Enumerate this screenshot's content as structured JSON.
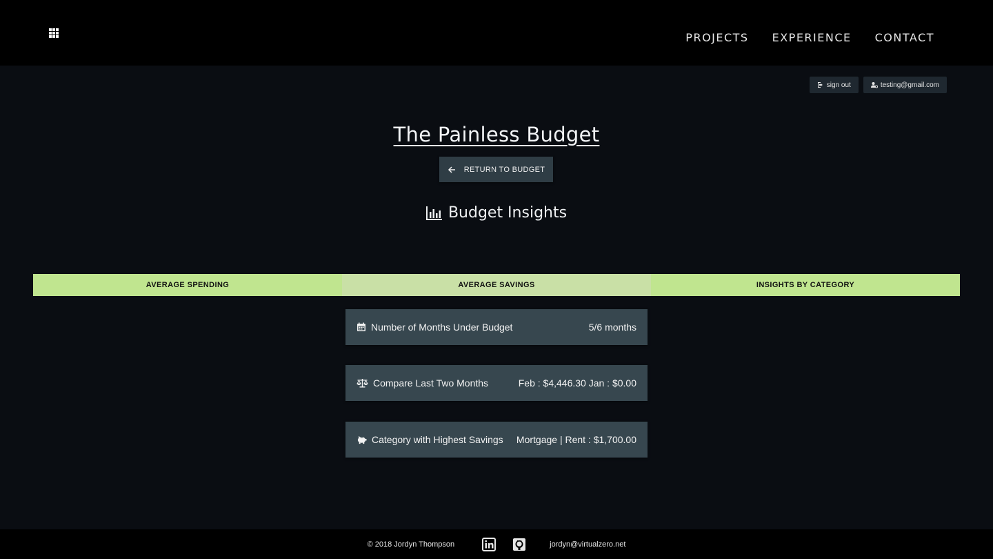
{
  "nav": {
    "menu_icon": "grid-icon",
    "links": [
      "PROJECTS",
      "EXPERIENCE",
      "CONTACT"
    ]
  },
  "user": {
    "sign_out": "sign out",
    "email": "testing@gmail.com"
  },
  "page": {
    "title": "The Painless Budget",
    "return_button": "RETURN TO BUDGET",
    "section_title": "Budget Insights"
  },
  "tabs": [
    {
      "label": "AVERAGE SPENDING"
    },
    {
      "label": "AVERAGE SAVINGS",
      "active": true
    },
    {
      "label": "INSIGHTS BY CATEGORY"
    }
  ],
  "cards": [
    {
      "icon": "calendar-icon",
      "label": "Number of Months Under Budget",
      "value": "5/6 months"
    },
    {
      "icon": "balance-scale-icon",
      "label": "Compare Last Two Months",
      "value": "Feb : $4,446.30 Jan : $0.00"
    },
    {
      "icon": "piggy-bank-icon",
      "label": "Category with Highest Savings",
      "value": "Mortgage | Rent : $1,700.00"
    }
  ],
  "footer": {
    "copyright": "© 2018 Jordyn Thompson",
    "email": "jordyn@virtualzero.net"
  },
  "colors": {
    "background": "#0a0d12",
    "tab_accent": "#c0e58f",
    "card_bg": "#37474f"
  }
}
